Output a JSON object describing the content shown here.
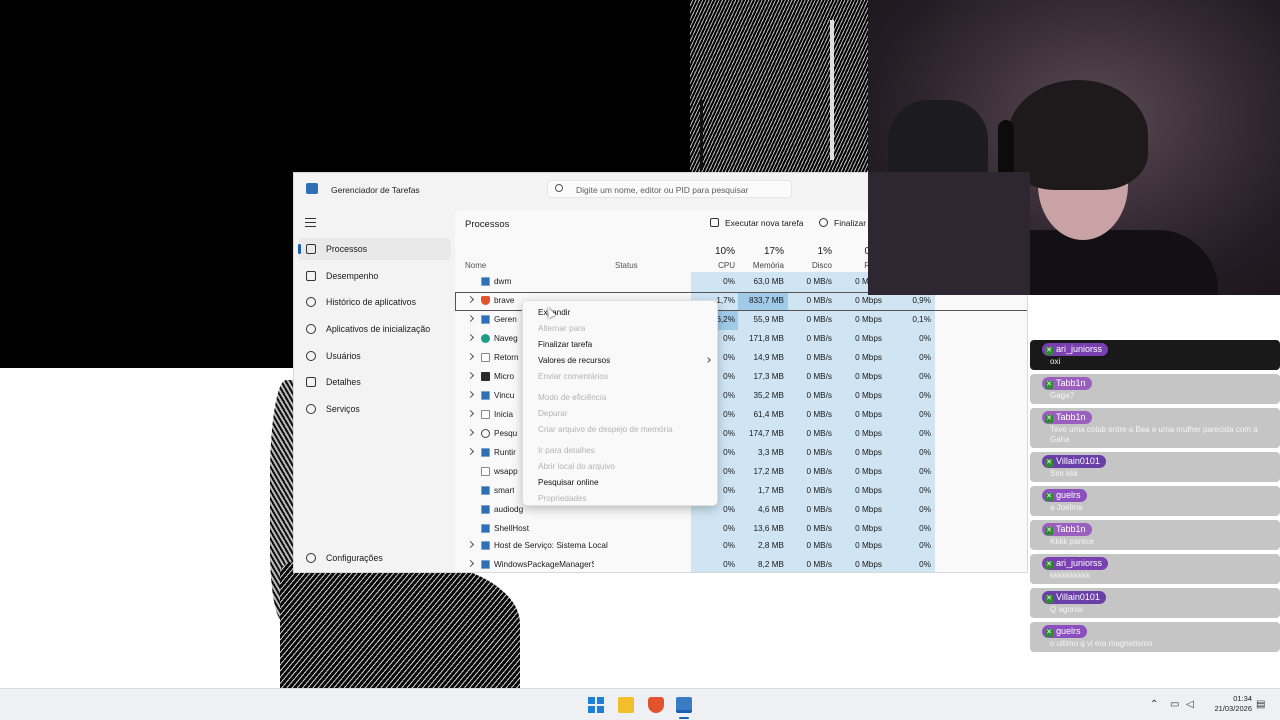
{
  "window": {
    "title": "Gerenciador de Tarefas",
    "search_placeholder": "Digite um nome, editor ou PID para pesquisar"
  },
  "nav": {
    "items": [
      {
        "label": "Processos",
        "icon": "processes-icon",
        "active": true
      },
      {
        "label": "Desempenho",
        "icon": "performance-icon"
      },
      {
        "label": "Histórico de aplicativos",
        "icon": "app-history-icon"
      },
      {
        "label": "Aplicativos de inicialização",
        "icon": "startup-apps-icon"
      },
      {
        "label": "Usuários",
        "icon": "users-icon"
      },
      {
        "label": "Detalhes",
        "icon": "details-icon"
      },
      {
        "label": "Serviços",
        "icon": "services-icon"
      }
    ],
    "settings_label": "Configurações"
  },
  "content": {
    "title": "Processos",
    "run_task_label": "Executar nova tarefa",
    "end_task_label": "Finalizar t",
    "columns": {
      "name": "Nome",
      "status": "Status",
      "cpu_pct": "10%",
      "cpu": "CPU",
      "mem_pct": "17%",
      "mem": "Memória",
      "disk_pct": "1%",
      "disk": "Disco",
      "net_pct": "0",
      "net": "R"
    },
    "rows": [
      {
        "name": "dwm",
        "icon": "window-icon",
        "expand": false,
        "cpu": "0%",
        "mem": "63,0 MB",
        "disk": "0 MB/s",
        "net": "0 Mbps",
        "gpu": ""
      },
      {
        "name": "brave",
        "icon": "brave-icon",
        "expand": true,
        "cpu": "1,7%",
        "mem": "833,7 MB",
        "disk": "0 MB/s",
        "net": "0 Mbps",
        "gpu": "0,9%",
        "selected": true
      },
      {
        "name": "Geren",
        "icon": "window-icon",
        "expand": true,
        "cpu": "6,2%",
        "mem": "55,9 MB",
        "disk": "0 MB/s",
        "net": "0 Mbps",
        "gpu": "0,1%"
      },
      {
        "name": "Naveg",
        "icon": "edge-icon",
        "expand": true,
        "cpu": "0%",
        "mem": "171,8 MB",
        "disk": "0 MB/s",
        "net": "0 Mbps",
        "gpu": "0%"
      },
      {
        "name": "Retorn",
        "icon": "blank-icon",
        "expand": true,
        "cpu": "0%",
        "mem": "14,9 MB",
        "disk": "0 MB/s",
        "net": "0 Mbps",
        "gpu": "0%"
      },
      {
        "name": "Micro",
        "icon": "dark-icon",
        "expand": true,
        "cpu": "0%",
        "mem": "17,3 MB",
        "disk": "0 MB/s",
        "net": "0 Mbps",
        "gpu": "0%"
      },
      {
        "name": "Vincu",
        "icon": "window-icon",
        "expand": true,
        "cpu": "0%",
        "mem": "35,2 MB",
        "disk": "0 MB/s",
        "net": "0 Mbps",
        "gpu": "0%"
      },
      {
        "name": "Inicia",
        "icon": "blank-icon",
        "expand": true,
        "cpu": "0%",
        "mem": "61,4 MB",
        "disk": "0 MB/s",
        "net": "0 Mbps",
        "gpu": "0%"
      },
      {
        "name": "Pesqu",
        "icon": "search-icon",
        "expand": true,
        "cpu": "0%",
        "mem": "174,7 MB",
        "disk": "0 MB/s",
        "net": "0 Mbps",
        "gpu": "0%"
      },
      {
        "name": "Runtir",
        "icon": "window-icon",
        "expand": true,
        "cpu": "0%",
        "mem": "3,3 MB",
        "disk": "0 MB/s",
        "net": "0 Mbps",
        "gpu": "0%"
      },
      {
        "name": "wsapp",
        "icon": "blank-icon",
        "expand": false,
        "cpu": "0%",
        "mem": "17,2 MB",
        "disk": "0 MB/s",
        "net": "0 Mbps",
        "gpu": "0%"
      },
      {
        "name": "smart",
        "icon": "window-icon",
        "expand": false,
        "cpu": "0%",
        "mem": "1,7 MB",
        "disk": "0 MB/s",
        "net": "0 Mbps",
        "gpu": "0%"
      },
      {
        "name": "audiodg",
        "icon": "window-icon",
        "expand": false,
        "cpu": "0%",
        "mem": "4,6 MB",
        "disk": "0 MB/s",
        "net": "0 Mbps",
        "gpu": "0%"
      },
      {
        "name": "ShellHost",
        "icon": "window-icon",
        "expand": false,
        "cpu": "0%",
        "mem": "13,6 MB",
        "disk": "0 MB/s",
        "net": "0 Mbps",
        "gpu": "0%"
      },
      {
        "name": "Host de Serviço: Sistema Local",
        "icon": "window-icon",
        "expand": true,
        "cpu": "0%",
        "mem": "2,8 MB",
        "disk": "0 MB/s",
        "net": "0 Mbps",
        "gpu": "0%"
      },
      {
        "name": "WindowsPackageManagerSer...",
        "icon": "window-icon",
        "expand": true,
        "cpu": "0%",
        "mem": "8,2 MB",
        "disk": "0 MB/s",
        "net": "0 Mbps",
        "gpu": "0%"
      }
    ]
  },
  "context_menu": {
    "items": [
      {
        "label": "Expandir",
        "enabled": true
      },
      {
        "label": "Alternar para",
        "enabled": false
      },
      {
        "label": "Finalizar tarefa",
        "enabled": true
      },
      {
        "label": "Valores de recursos",
        "enabled": true,
        "submenu": true
      },
      {
        "label": "Enviar comentários",
        "enabled": false
      },
      {
        "label": "Modo de eficiência",
        "enabled": false
      },
      {
        "label": "Depurar",
        "enabled": false
      },
      {
        "label": "Criar arquivo de despejo de memória",
        "enabled": false
      },
      {
        "label": "Ir para detalhes",
        "enabled": false
      },
      {
        "label": "Abrir local do arquivo",
        "enabled": false
      },
      {
        "label": "Pesquisar online",
        "enabled": true
      },
      {
        "label": "Propriedades",
        "enabled": false
      }
    ]
  },
  "chat": {
    "messages": [
      {
        "user": "ari_juniorss",
        "text": "oxi",
        "color": "#7a3fb0"
      },
      {
        "user": "Tabb1n",
        "text": "Gaga?",
        "color": "#9a5fc0"
      },
      {
        "user": "Tabb1n",
        "text": "Teve uma colab entre a Bea e uma mulher parecida com a Gaha",
        "color": "#9a5fc0"
      },
      {
        "user": "Villain0101",
        "text": "Sim kkk",
        "color": "#6b3fa8"
      },
      {
        "user": "guelrs",
        "text": "a Joelma",
        "color": "#8c4fc0"
      },
      {
        "user": "Tabb1n",
        "text": "Kkkk parece",
        "color": "#9a5fc0"
      },
      {
        "user": "ari_juniorss",
        "text": "kkkkkkkkkk",
        "color": "#7a3fb0"
      },
      {
        "user": "Villain0101",
        "text": "Q agonia",
        "color": "#6b3fa8"
      },
      {
        "user": "guelrs",
        "text": "o ultimo q vi era magnetismo",
        "color": "#8c4fc0"
      }
    ]
  },
  "taskbar": {
    "apps": [
      "windows-start-icon",
      "file-explorer-icon",
      "brave-icon",
      "task-manager-icon"
    ],
    "time": "01:34",
    "date": "21/03/2026"
  },
  "colors": {
    "accent": "#1a5fb4",
    "heat_light": "#cfe5f4",
    "heat_strong": "#9fcbe9"
  }
}
